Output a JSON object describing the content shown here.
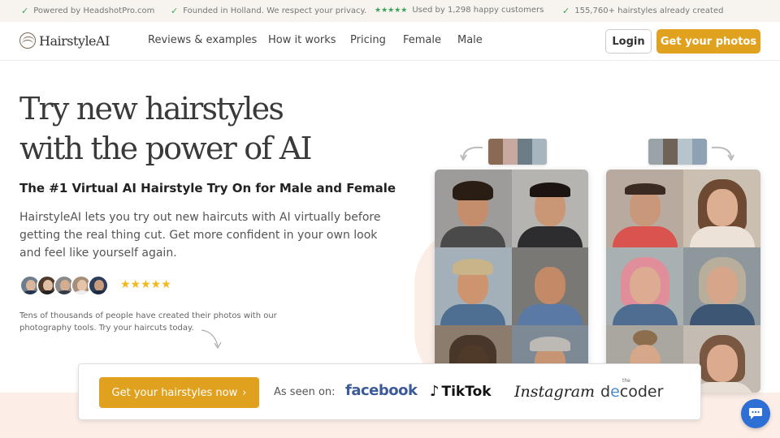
{
  "topbar": {
    "items": [
      {
        "text": "Powered by HeadshotPro.com"
      },
      {
        "text": "Founded in Holland. We respect your privacy."
      },
      {
        "stars": "★★★★★",
        "text": "Used by 1,298 happy customers"
      },
      {
        "text": "155,760+ hairstyles already created"
      }
    ]
  },
  "nav": {
    "logo": "HairstyleAI",
    "links": [
      "Reviews & examples",
      "How it works",
      "Pricing",
      "Female",
      "Male"
    ],
    "login": "Login",
    "cta": "Get your photos"
  },
  "hero": {
    "title_line1": "Try new hairstyles",
    "title_line2": "with the power of AI",
    "subtitle": "The #1 Virtual AI Hairstyle Try On for Male and Female",
    "description": "HairstyleAI lets you try out new haircuts with AI virtually before getting the real thing cut. Get more confident in your own look and feel like yourself again.",
    "stars": "★★★★★",
    "note": "Tens of thousands of people have created their photos with our photography tools. Try your haircuts today."
  },
  "bar": {
    "cta": "Get your hairstyles now",
    "cta_chevron": "›",
    "as_seen_on": "As seen on:",
    "brands": {
      "facebook": "facebook",
      "tiktok": "TikTok",
      "instagram": "Instagram",
      "decoder_the": "the",
      "decoder_d": "d",
      "decoder_e": "e",
      "decoder_rest": "coder"
    }
  },
  "icons": {
    "check": "check-icon",
    "chat": "chat-icon",
    "logo": "hair-logo-icon"
  },
  "colors": {
    "accent": "#e0a11e",
    "check_green": "#3aa35b",
    "star_gold": "#f2b91a",
    "chat_blue": "#2e6fd6",
    "facebook_blue": "#3b5b9a"
  }
}
